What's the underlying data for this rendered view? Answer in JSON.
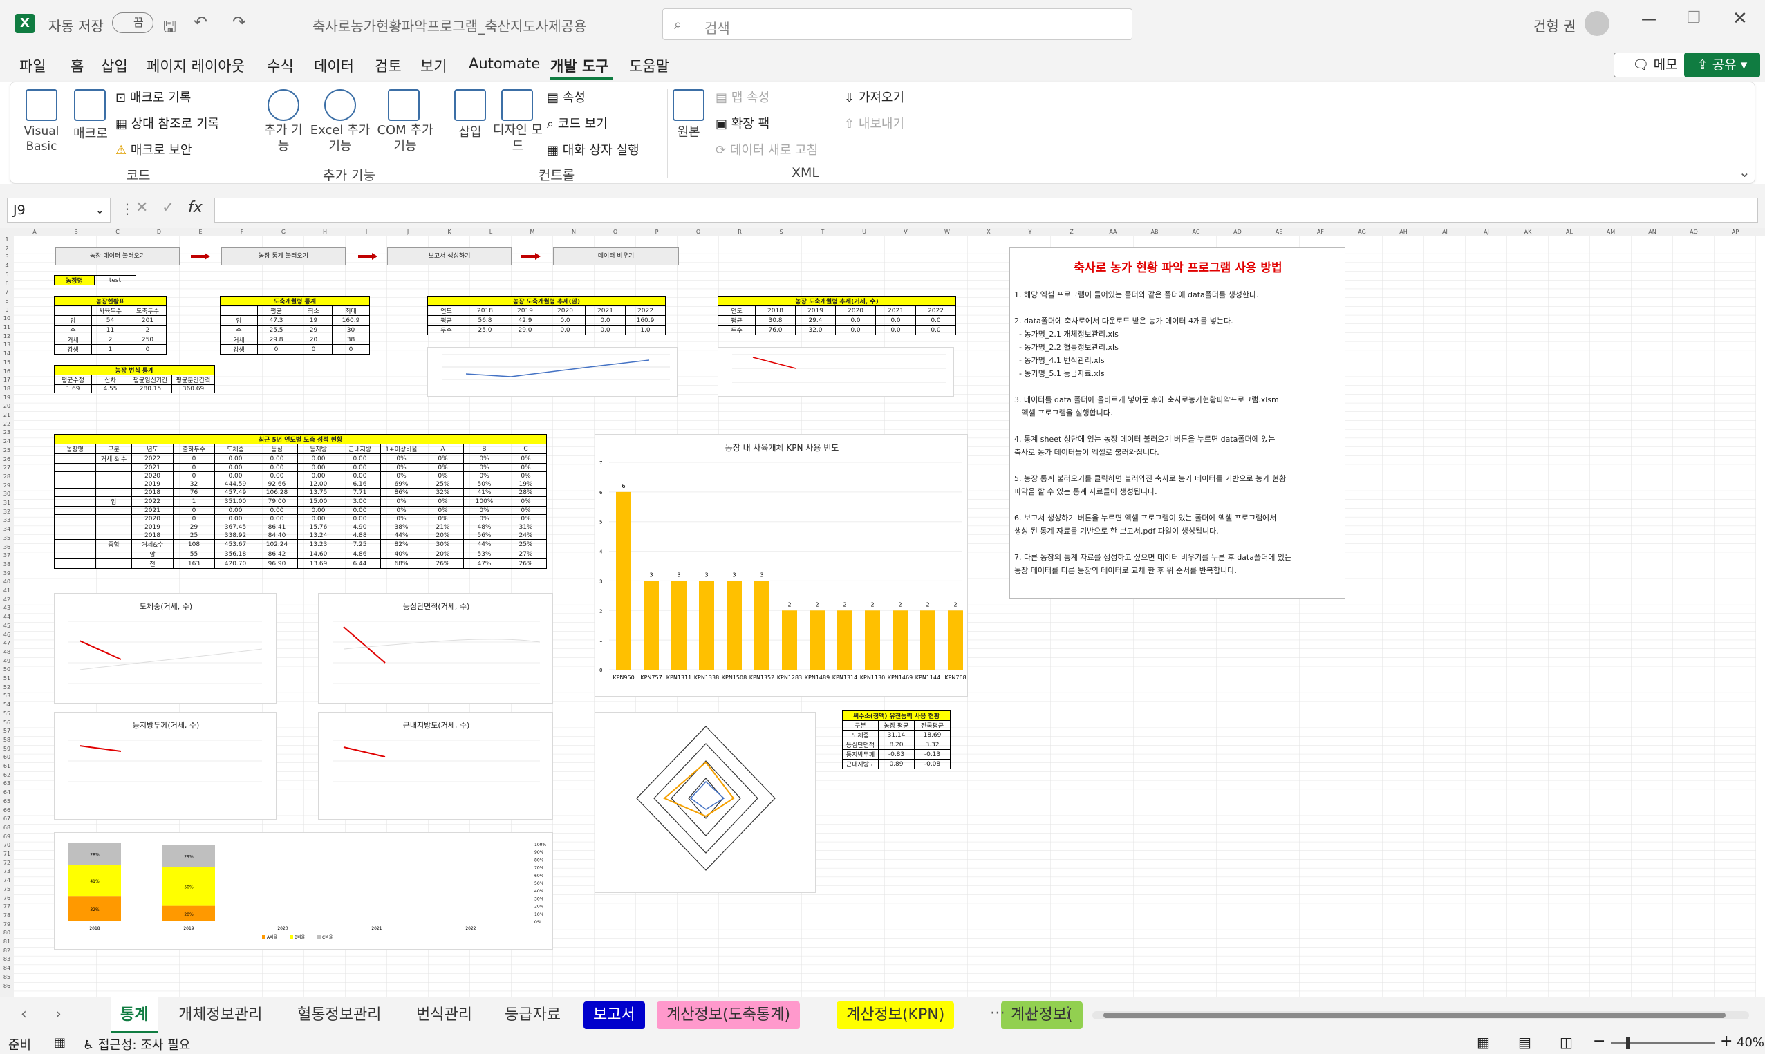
{
  "titlebar": {
    "autosave_label": "자동 저장",
    "autosave_state": "끔",
    "filename": "축사로농가현황파악프로그램_축산지도사제공용",
    "search_placeholder": "검색",
    "user": "건형 권"
  },
  "tabs": [
    "파일",
    "홈",
    "삽입",
    "페이지 레이아웃",
    "수식",
    "데이터",
    "검토",
    "보기",
    "Automate",
    "개발 도구",
    "도움말"
  ],
  "active_tab": "개발 도구",
  "memo_label": "메모",
  "share_label": "공유",
  "ribbon": {
    "code": {
      "group": "코드",
      "vb": "Visual Basic",
      "macro": "매크로",
      "record": "매크로 기록",
      "relref": "상대 참조로 기록",
      "security": "매크로 보안"
    },
    "addins": {
      "group": "추가 기능",
      "addin": "추가 기능",
      "excel": "Excel 추가 기능",
      "com": "COM 추가 기능"
    },
    "controls": {
      "group": "컨트롤",
      "insert": "삽입",
      "design": "디자인 모드",
      "props": "속성",
      "code": "코드 보기",
      "dialog": "대화 상자 실행"
    },
    "xml": {
      "group": "XML",
      "source": "원본",
      "mapprops": "맵 속성",
      "packs": "확장 팩",
      "refresh": "데이터 새로 고침",
      "import": "가져오기",
      "export": "내보내기"
    }
  },
  "namebox": "J9",
  "columns": [
    "A",
    "B",
    "C",
    "D",
    "E",
    "F",
    "G",
    "H",
    "I",
    "J",
    "K",
    "L",
    "M",
    "N",
    "O",
    "P",
    "Q",
    "R",
    "S",
    "T",
    "U",
    "V",
    "W",
    "X",
    "Y",
    "Z",
    "AA",
    "AB",
    "AC",
    "AD",
    "AE",
    "AF",
    "AG",
    "AH",
    "AI",
    "AJ",
    "AK",
    "AL",
    "AM",
    "AN",
    "AO",
    "AP"
  ],
  "sheet": {
    "buttons": [
      "농장 데이터 불러오기",
      "농장 통계 불러오기",
      "보고서 생성하기",
      "데이터 비우기"
    ],
    "farm_label": "농장명",
    "farm_value": "test",
    "t1": {
      "title": "농장현황표",
      "head": [
        "",
        "사육두수",
        "도축두수"
      ],
      "rows": [
        [
          "암",
          "54",
          "201"
        ],
        [
          "수",
          "11",
          "2"
        ],
        [
          "거세",
          "2",
          "250"
        ],
        [
          "강생",
          "1",
          "0"
        ]
      ]
    },
    "t2": {
      "title": "도축개월령 통계",
      "head": [
        "",
        "평균",
        "최소",
        "최대"
      ],
      "rows": [
        [
          "암",
          "47.3",
          "19",
          "160.9"
        ],
        [
          "수",
          "25.5",
          "29",
          "30"
        ],
        [
          "거세",
          "29.8",
          "20",
          "38"
        ],
        [
          "강생",
          "0",
          "0",
          "0"
        ]
      ]
    },
    "t3": {
      "title": "농장 도축개월령 추세(암)",
      "head": [
        "연도",
        "2018",
        "2019",
        "2020",
        "2021",
        "2022"
      ],
      "rows": [
        [
          "평균",
          "56.8",
          "42.9",
          "0.0",
          "0.0",
          "160.9"
        ],
        [
          "두수",
          "25.0",
          "29.0",
          "0.0",
          "0.0",
          "1.0"
        ]
      ]
    },
    "t4": {
      "title": "농장 도축개월령 추세(거세, 수)",
      "head": [
        "연도",
        "2018",
        "2019",
        "2020",
        "2021",
        "2022"
      ],
      "rows": [
        [
          "평균",
          "30.8",
          "29.4",
          "0.0",
          "0.0",
          "0.0"
        ],
        [
          "두수",
          "76.0",
          "32.0",
          "0.0",
          "0.0",
          "0.0"
        ]
      ]
    },
    "t5": {
      "title": "농장 번식 통계",
      "head": [
        "평균수정",
        "산차",
        "평균임신기간",
        "평균분만간격"
      ],
      "rows": [
        [
          "1.69",
          "4.55",
          "280.15",
          "360.69"
        ]
      ]
    },
    "t6": {
      "title": "최근 5년 연도별 도축 성적 현황",
      "head": [
        "농장명",
        "구분",
        "년도",
        "출하두수",
        "도체중",
        "등심",
        "등지방",
        "근내지방",
        "1+이상비율",
        "A",
        "B",
        "C"
      ],
      "rows": [
        [
          "",
          "거세 & 수",
          "2022",
          "0",
          "0.00",
          "0.00",
          "0.00",
          "0.00",
          "0%",
          "0%",
          "0%",
          "0%"
        ],
        [
          "",
          "",
          "2021",
          "0",
          "0.00",
          "0.00",
          "0.00",
          "0.00",
          "0%",
          "0%",
          "0%",
          "0%"
        ],
        [
          "",
          "",
          "2020",
          "0",
          "0.00",
          "0.00",
          "0.00",
          "0.00",
          "0%",
          "0%",
          "0%",
          "0%"
        ],
        [
          "",
          "",
          "2019",
          "32",
          "444.59",
          "92.66",
          "12.00",
          "6.16",
          "69%",
          "25%",
          "50%",
          "19%"
        ],
        [
          "",
          "",
          "2018",
          "76",
          "457.49",
          "106.28",
          "13.75",
          "7.71",
          "86%",
          "32%",
          "41%",
          "28%"
        ],
        [
          "",
          "암",
          "2022",
          "1",
          "351.00",
          "79.00",
          "15.00",
          "3.00",
          "0%",
          "0%",
          "100%",
          "0%"
        ],
        [
          "",
          "",
          "2021",
          "0",
          "0.00",
          "0.00",
          "0.00",
          "0.00",
          "0%",
          "0%",
          "0%",
          "0%"
        ],
        [
          "",
          "",
          "2020",
          "0",
          "0.00",
          "0.00",
          "0.00",
          "0.00",
          "0%",
          "0%",
          "0%",
          "0%"
        ],
        [
          "",
          "",
          "2019",
          "29",
          "367.45",
          "86.41",
          "15.76",
          "4.90",
          "38%",
          "21%",
          "48%",
          "31%"
        ],
        [
          "",
          "",
          "2018",
          "25",
          "338.92",
          "84.40",
          "13.24",
          "4.88",
          "44%",
          "20%",
          "56%",
          "24%"
        ],
        [
          "",
          "종합",
          "거세&수",
          "108",
          "453.67",
          "102.24",
          "13.23",
          "7.25",
          "82%",
          "30%",
          "44%",
          "25%"
        ],
        [
          "",
          "",
          "암",
          "55",
          "356.18",
          "86.42",
          "14.60",
          "4.86",
          "40%",
          "20%",
          "53%",
          "27%"
        ],
        [
          "",
          "",
          "전",
          "163",
          "420.70",
          "96.90",
          "13.69",
          "6.44",
          "68%",
          "26%",
          "47%",
          "26%"
        ]
      ]
    },
    "t7": {
      "title": "씨수소(정액) 유전능력 사용 현황",
      "head": [
        "구분",
        "농장 평균",
        "전국평균"
      ],
      "rows": [
        [
          "도체중",
          "31.14",
          "18.69"
        ],
        [
          "등심단면적",
          "8.20",
          "3.32"
        ],
        [
          "등지방두께",
          "-0.83",
          "-0.13"
        ],
        [
          "근내지방도",
          "0.89",
          "-0.08"
        ]
      ]
    },
    "howto": {
      "title": "축사로 농가 현황 파악 프로그램 사용 방법",
      "lines": [
        "1. 해당 엑셀 프로그램이 들어있는 폴더와 같은 폴더에 data폴더를 생성한다.",
        "",
        "2. data폴더에 축사로에서 다운로드 받은 농가 데이터 4개를 넣는다.",
        "  - 농가명_2.1 개체정보관리.xls",
        "  - 농가명_2.2 혈통정보관리.xls",
        "  - 농가명_4.1 번식관리.xls",
        "  - 농가명_5.1 등급자료.xls",
        "",
        "3. 데이터를 data 폴더에 올바르게 넣어둔 후에 축사로농가현황파악프로그램.xlsm",
        "   엑셀 프로그램을 실행합니다.",
        "",
        "4. 통계 sheet 상단에 있는 농장 데이터 불러오기 버튼을 누르면 data폴더에 있는",
        "축사로 농가 데이터들이 엑셀로 불러와집니다.",
        "",
        "5. 농장 통계 불러오기를 클릭하면 불러와진 축사로 농가 데이터를 기반으로 농가 현황",
        "파악을 할 수 있는 통계 자료들이 생성됩니다.",
        "",
        "6. 보고서 생성하기 버튼을 누르면 엑셀 프로그램이 있는 폴더에 엑셀 프로그램에서",
        "생성 된 통계 자료를 기반으로 한 보고서.pdf 파일이 생성됩니다.",
        "",
        "7. 다른 농장의 통계 자료를 생성하고 싶으면 데이터 비우기를 누른 후 data폴더에 있는",
        "농장 데이터를 다른 농장의 데이터로 교체 한 후 위 순서를 반복합니다."
      ]
    },
    "chart_titles": {
      "kpn": "농장 내 사육개체 KPN 사용 빈도",
      "c1": "도체중(거세, 수)",
      "c2": "등심단면적(거세, 수)",
      "c3": "등지방두께(거세, 수)",
      "c4": "근내지방도(거세, 수)"
    },
    "legend": [
      "A비율",
      "B비율",
      "C비율"
    ]
  },
  "chart_data": [
    {
      "type": "bar",
      "title": "농장 내 사육개체 KPN 사용 빈도",
      "categories": [
        "KPN950",
        "KPN757",
        "KPN1311",
        "KPN1338",
        "KPN1508",
        "KPN1352",
        "KPN1283",
        "KPN1489",
        "KPN1314",
        "KPN1130",
        "KPN1469",
        "KPN1144",
        "KPN768"
      ],
      "values": [
        6,
        3,
        3,
        3,
        3,
        3,
        2,
        2,
        2,
        2,
        2,
        2,
        2
      ],
      "ylim": [
        0,
        7
      ]
    },
    {
      "type": "bar",
      "stacked": true,
      "categories": [
        "2018",
        "2019",
        "2020",
        "2021",
        "2022"
      ],
      "series": [
        {
          "name": "A비율",
          "values": [
            32,
            20,
            0,
            0,
            0
          ]
        },
        {
          "name": "B비율",
          "values": [
            41,
            50,
            0,
            0,
            0
          ]
        },
        {
          "name": "C비율",
          "values": [
            28,
            29,
            0,
            0,
            0
          ]
        }
      ],
      "ylim": [
        0,
        100
      ]
    }
  ],
  "sheet_tabs": [
    {
      "name": "통계",
      "color": ""
    },
    {
      "name": "개체정보관리",
      "color": ""
    },
    {
      "name": "혈통정보관리",
      "color": ""
    },
    {
      "name": "번식관리",
      "color": ""
    },
    {
      "name": "등급자료",
      "color": ""
    },
    {
      "name": "보고서",
      "color": "#0000cc"
    },
    {
      "name": "계산정보(도축통계)",
      "color": "#ff99cc"
    },
    {
      "name": "계산정보(KPN)",
      "color": "#ffff00"
    },
    {
      "name": "계산정보(",
      "color": "#92d050"
    }
  ],
  "status": {
    "ready": "준비",
    "access": "접근성: 조사 필요",
    "zoom": "40%"
  }
}
